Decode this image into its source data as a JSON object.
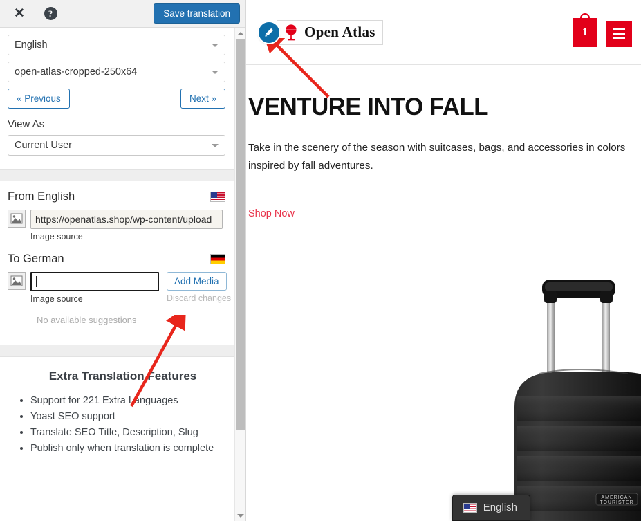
{
  "translation_panel": {
    "toolbar": {
      "close_icon": "close-icon",
      "help_icon": "help-icon",
      "save_label": "Save translation"
    },
    "language_select": {
      "value": "English",
      "icon": "chevron-down-icon"
    },
    "string_select": {
      "value": "open-atlas-cropped-250x64",
      "icon": "chevron-down-icon"
    },
    "previous_label": "« Previous",
    "next_label": "Next »",
    "view_as_label": "View As",
    "view_as_select": {
      "value": "Current User",
      "icon": "chevron-down-icon"
    },
    "source": {
      "heading": "From English",
      "flag": "us-flag-icon",
      "image_icon": "image-placeholder-icon",
      "value": "https://openatlas.shop/wp-content/upload",
      "sub_label": "Image source"
    },
    "target": {
      "heading": "To German",
      "flag": "de-flag-icon",
      "image_icon": "image-placeholder-icon",
      "value": "",
      "sub_label": "Image source",
      "add_media_label": "Add Media",
      "discard_label": "Discard changes",
      "suggestions_label": "No available suggestions"
    },
    "features": {
      "title": "Extra Translation Features",
      "items": [
        "Support for 221 Extra Languages",
        "Yoast SEO support",
        "Translate SEO Title, Description, Slug",
        "Publish only when translation is complete"
      ]
    },
    "scrollbar": {
      "up_icon": "scroll-up-arrow-icon",
      "down_icon": "scroll-down-arrow-icon"
    }
  },
  "site_preview": {
    "header": {
      "edit_icon": "pencil-edit-icon",
      "logo_icon": "globe-icon",
      "logo_text": "Open Atlas",
      "cart_icon": "shopping-bag-icon",
      "cart_count": "1",
      "menu_icon": "hamburger-menu-icon"
    },
    "hero": {
      "title": "VENTURE INTO FALL",
      "subtitle": "Take in the scenery of the season with suitcases, bags, and accessories in colors inspired by fall adventures.",
      "cta_label": "Shop Now",
      "product_image": "black-suitcase-image",
      "product_brand": "AMERICAN TOURISTER"
    },
    "language_switcher": {
      "flag": "us-flag-icon",
      "label": "English"
    }
  },
  "colors": {
    "accent_blue": "#2271b1",
    "brand_red": "#e2001a",
    "link_red": "#e8344b",
    "annotation_red": "#e8261c",
    "panel_gray": "#f1f1f1"
  }
}
